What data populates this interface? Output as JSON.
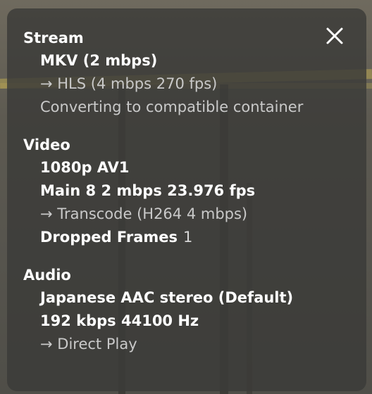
{
  "colors": {
    "panel_bg": "rgba(58,58,56,0.82)",
    "text_primary": "#ffffff",
    "text_secondary": "#c9c9c9"
  },
  "close_icon": "close-x-icon",
  "stream": {
    "title": "Stream",
    "container": "MKV (2 mbps)",
    "output": "→ HLS (4 mbps 270 fps)",
    "note": "Converting to compatible container"
  },
  "video": {
    "title": "Video",
    "resolution_codec": "1080p AV1",
    "profile": "Main 8 2 mbps 23.976 fps",
    "transcode": "→ Transcode (H264 4 mbps)",
    "dropped_frames_label": "Dropped Frames",
    "dropped_frames_value": "1"
  },
  "audio": {
    "title": "Audio",
    "track": "Japanese AAC stereo (Default)",
    "bitrate": "192 kbps 44100 Hz",
    "mode": "→ Direct Play"
  }
}
